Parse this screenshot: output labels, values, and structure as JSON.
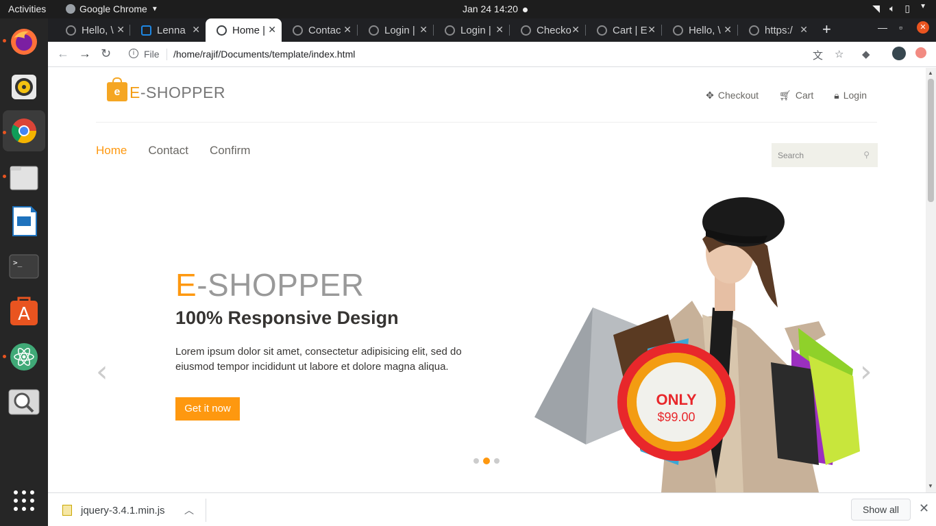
{
  "system": {
    "activities": "Activities",
    "app_name": "Google Chrome",
    "clock": "Jan 24  14:20"
  },
  "dock": [
    "Firefox",
    "Rhythmbox",
    "Google Chrome",
    "Files",
    "LibreOffice Impress",
    "Terminal",
    "Ubuntu Software",
    "Atom",
    "Image Viewer",
    "Show Applications"
  ],
  "tabs": [
    {
      "label": "Hello, \\"
    },
    {
      "label": "Lenna"
    },
    {
      "label": "Home |"
    },
    {
      "label": "Contac"
    },
    {
      "label": "Login |"
    },
    {
      "label": "Login |"
    },
    {
      "label": "Checko"
    },
    {
      "label": "Cart | E"
    },
    {
      "label": "Hello, \\"
    },
    {
      "label": "https:/"
    }
  ],
  "address": {
    "scheme_label": "File",
    "url": "/home/rajif/Documents/template/index.html"
  },
  "site": {
    "logo_letter": "e",
    "logo_e": "E",
    "logo_rest": "-SHOPPER",
    "top_links": {
      "checkout": "Checkout",
      "cart": "Cart",
      "login": "Login"
    },
    "nav": {
      "home": "Home",
      "contact": "Contact",
      "confirm": "Confirm"
    },
    "search_placeholder": "Search",
    "slide": {
      "title_e": "E",
      "title_rest": "-SHOPPER",
      "subtitle": "100% Responsive Design",
      "text": "Lorem ipsum dolor sit amet, consectetur adipisicing elit, sed do eiusmod tempor incididunt ut labore et dolore magna aliqua.",
      "cta": "Get it now",
      "badge_only": "ONLY",
      "badge_price": "$99.00"
    },
    "carousel_active_index": 1
  },
  "downloads": {
    "file": "jquery-3.4.1.min.js",
    "show_all": "Show all"
  }
}
